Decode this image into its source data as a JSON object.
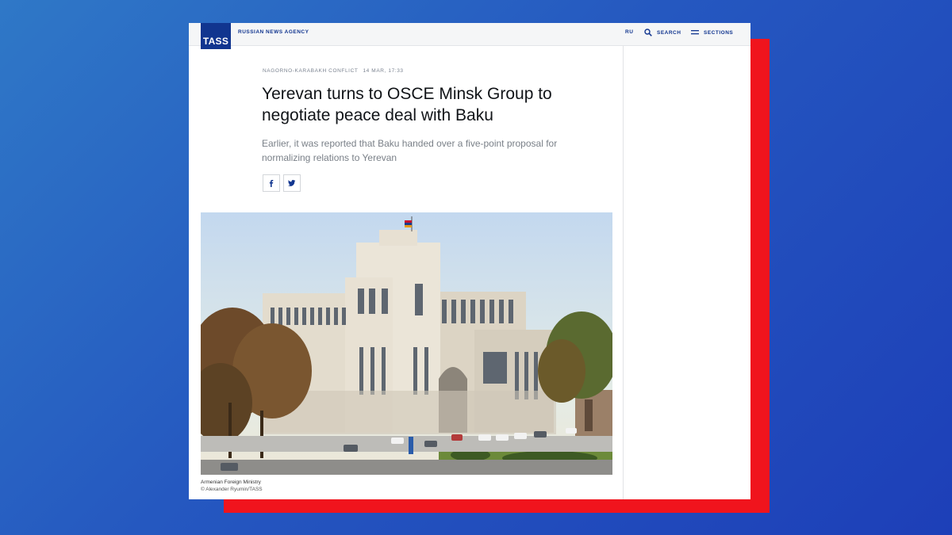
{
  "header": {
    "logo_text": "TASS",
    "agency_label": "RUSSIAN NEWS AGENCY",
    "nav": {
      "language": "RU",
      "search_label": "SEARCH",
      "sections_label": "SECTIONS"
    },
    "brand_color": "#11358f"
  },
  "article": {
    "category": "NAGORNO-KARABAKH CONFLICT",
    "timestamp": "14 MAR, 17:33",
    "headline": "Yerevan turns to OSCE Minsk Group to negotiate peace deal with Baku",
    "lead": "Earlier, it was reported that Baku handed over a five-point proposal for normalizing relations to Yerevan",
    "share": [
      {
        "icon": "facebook-icon",
        "glyph": "f"
      },
      {
        "icon": "twitter-icon",
        "glyph": "bird"
      }
    ],
    "photo": {
      "caption": "Armenian Foreign Ministry",
      "credit": "© Alexander Ryumin/TASS"
    }
  },
  "colors": {
    "background_gradient": [
      "#2f78c7",
      "#1d3fb8"
    ],
    "accent_red": "#f0141d"
  }
}
